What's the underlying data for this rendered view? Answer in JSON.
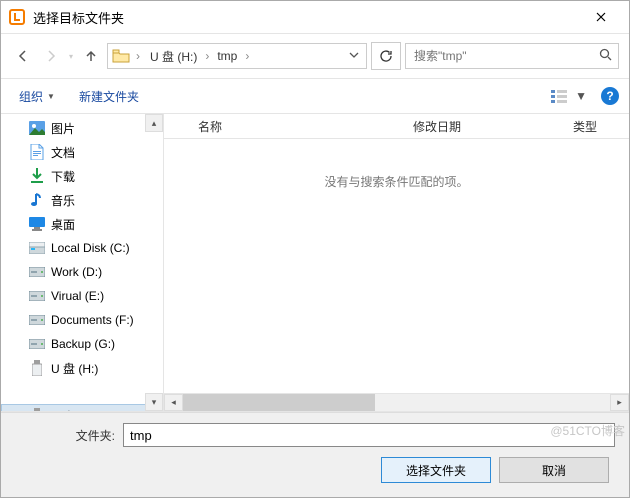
{
  "title": "选择目标文件夹",
  "nav": {
    "breadcrumbs": [
      "U 盘 (H:)",
      "tmp"
    ],
    "search_placeholder": "搜索\"tmp\""
  },
  "toolbar": {
    "organize": "组织",
    "new_folder": "新建文件夹"
  },
  "columns": {
    "name": "名称",
    "modified": "修改日期",
    "type": "类型"
  },
  "empty_text": "没有与搜索条件匹配的项。",
  "sidebar": {
    "items": [
      {
        "id": "pictures",
        "label": "图片",
        "icon": "pictures",
        "selected": false
      },
      {
        "id": "documents",
        "label": "文档",
        "icon": "document",
        "selected": false
      },
      {
        "id": "downloads",
        "label": "下载",
        "icon": "download",
        "selected": false
      },
      {
        "id": "music",
        "label": "音乐",
        "icon": "music",
        "selected": false
      },
      {
        "id": "desktop",
        "label": "桌面",
        "icon": "desktop",
        "selected": false
      },
      {
        "id": "localdisk",
        "label": "Local Disk (C:)",
        "icon": "drive",
        "selected": false
      },
      {
        "id": "work",
        "label": "Work (D:)",
        "icon": "hdd",
        "selected": false
      },
      {
        "id": "virual",
        "label": "Virual (E:)",
        "icon": "hdd",
        "selected": false
      },
      {
        "id": "documentsf",
        "label": "Documents (F:)",
        "icon": "hdd",
        "selected": false
      },
      {
        "id": "backup",
        "label": "Backup (G:)",
        "icon": "hdd",
        "selected": false
      },
      {
        "id": "usb1",
        "label": "U 盘 (H:)",
        "icon": "usb",
        "selected": false
      },
      {
        "id": "spacer",
        "label": "",
        "icon": "none",
        "selected": false
      },
      {
        "id": "usb2",
        "label": "U 盘 (H:)",
        "icon": "usb",
        "selected": true
      }
    ]
  },
  "footer": {
    "folder_label": "文件夹:",
    "folder_value": "tmp",
    "select_btn": "选择文件夹",
    "cancel_btn": "取消"
  },
  "watermark": "@51CTO博客"
}
